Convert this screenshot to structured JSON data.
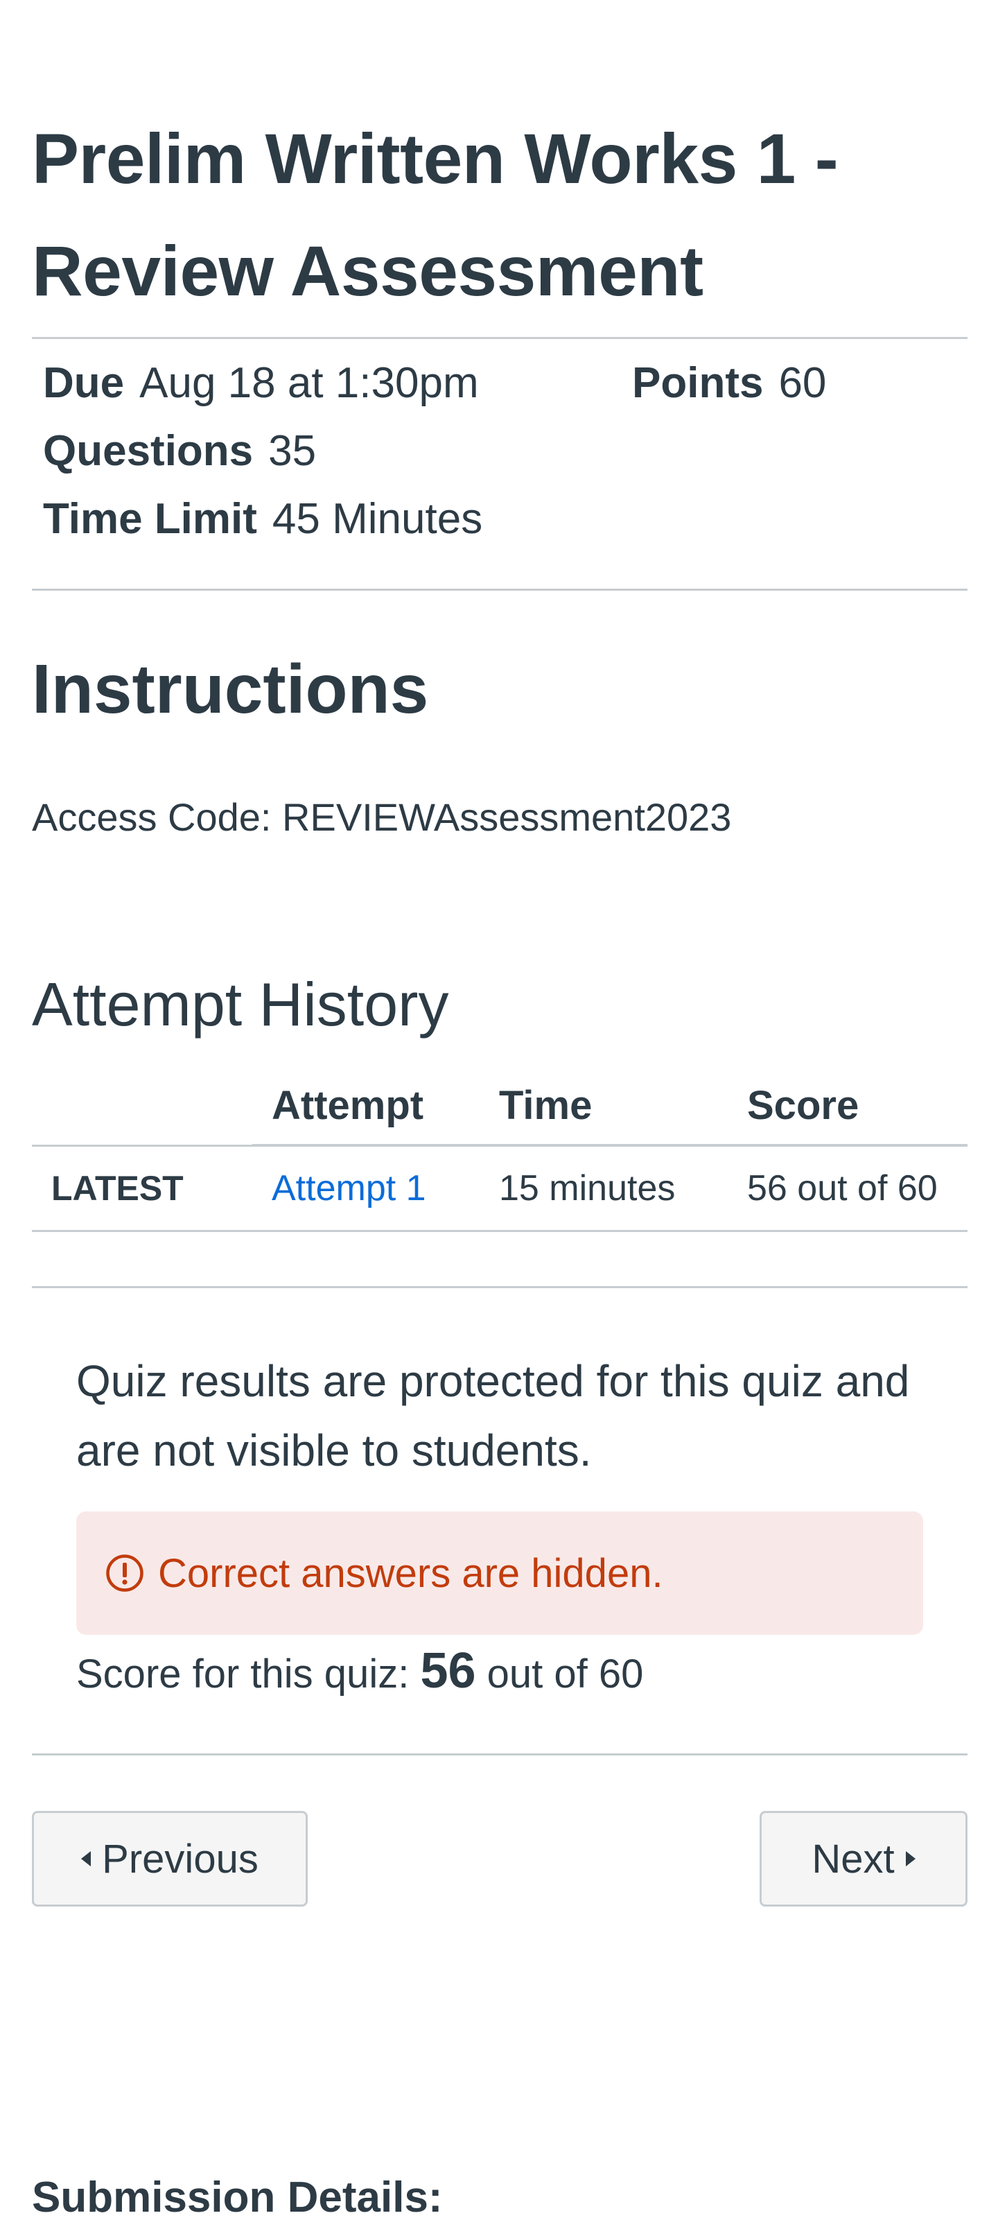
{
  "quiz": {
    "title": "Prelim Written Works 1 - Review Assessment"
  },
  "details": {
    "due_label": "Due",
    "due_value": "Aug 18 at 1:30pm",
    "points_label": "Points",
    "points_value": "60",
    "questions_label": "Questions",
    "questions_value": "35",
    "time_limit_label": "Time Limit",
    "time_limit_value": "45 Minutes"
  },
  "instructions": {
    "heading": "Instructions",
    "access_code": "Access Code: REVIEWAssessment2023"
  },
  "attempt_history": {
    "heading": "Attempt History",
    "columns": [
      "",
      "Attempt",
      "Time",
      "Score"
    ],
    "rows": [
      {
        "tag": "LATEST",
        "attempt": "Attempt 1",
        "time": "15 minutes",
        "score": "56 out of 60"
      }
    ]
  },
  "results": {
    "protected_message": "Quiz results are protected for this quiz and are not visible to students.",
    "alert_text": "Correct answers are hidden.",
    "score_prefix": "Score for this quiz:",
    "score_value": "56",
    "score_suffix": "out of 60"
  },
  "navigation": {
    "previous_label": "Previous",
    "next_label": "Next"
  },
  "submission": {
    "heading": "Submission Details:"
  },
  "colors": {
    "text": "#2d3b45",
    "link": "#0b6cd9",
    "alert_background": "#f8e9e8",
    "alert_text": "#c23c0d",
    "divider": "#c7cdd1",
    "button_background": "#f5f5f5"
  },
  "icons": {
    "alert": "warning-circle-icon",
    "previous": "caret-left-icon",
    "next": "caret-right-icon"
  }
}
